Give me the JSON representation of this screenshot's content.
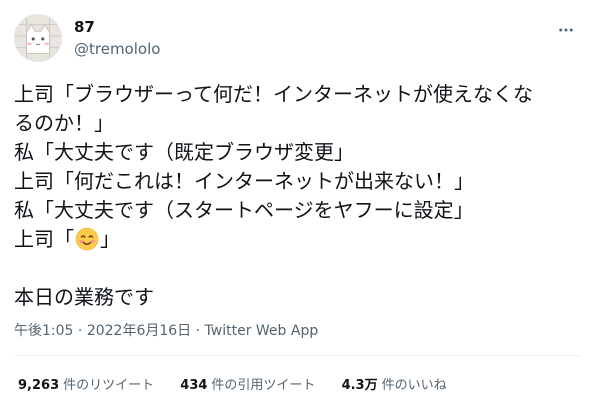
{
  "user": {
    "display_name": "87",
    "handle": "@tremololo",
    "avatar_icon": "cat-avatar-icon"
  },
  "tweet": {
    "lines": [
      "上司「ブラウザーって何だ！インターネットが使えなくな",
      "るのか！」",
      "私「大丈夫です（既定ブラウザ変更」",
      "上司「何だこれは！インターネットが出来ない！」",
      "私「大丈夫です（スタートページをヤフーに設定」"
    ],
    "emoji_line_prefix": "上司「",
    "emoji_line_suffix": "」",
    "emoji_icon": "smiling-face-with-smiling-eyes-icon",
    "closing": "本日の業務です"
  },
  "meta": {
    "time": "午後1:05",
    "sep1": " · ",
    "date": "2022年6月16日",
    "sep2": " · ",
    "source": "Twitter Web App"
  },
  "stats": {
    "retweets": {
      "count": "9,263",
      "label": "件のリツイート"
    },
    "quotes": {
      "count": "434",
      "label": "件の引用ツイート"
    },
    "likes": {
      "count": "4.3万",
      "label": "件のいいね"
    }
  },
  "colors": {
    "text": "#0f1419",
    "secondary": "#536471",
    "divider": "#eff3f4"
  }
}
